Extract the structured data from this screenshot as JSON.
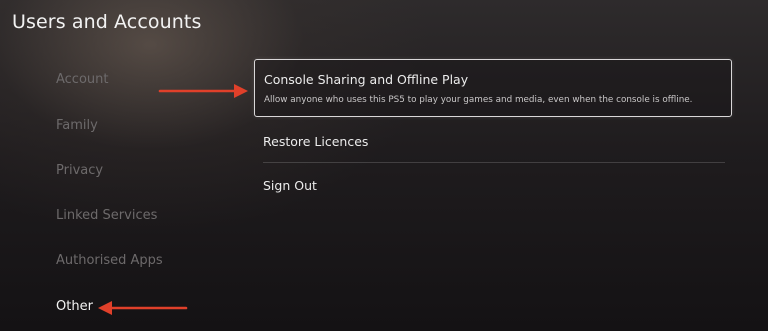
{
  "header": {
    "title": "Users and Accounts"
  },
  "sidebar": {
    "items": [
      {
        "label": "Account"
      },
      {
        "label": "Family"
      },
      {
        "label": "Privacy"
      },
      {
        "label": "Linked Services"
      },
      {
        "label": "Authorised Apps"
      },
      {
        "label": "Other",
        "active": true
      }
    ]
  },
  "main": {
    "options": [
      {
        "title": "Console Sharing and Offline Play",
        "description": "Allow anyone who uses this PS5 to play your games and media, even when the console is offline.",
        "focused": true
      },
      {
        "title": "Restore Licences"
      },
      {
        "title": "Sign Out"
      }
    ]
  },
  "annotations": {
    "arrow_color": "#e0402a",
    "arrows": [
      "arrow-right-icon",
      "arrow-left-icon"
    ]
  },
  "colors": {
    "background": "#1f1c1e",
    "text_primary": "#f2f2f2",
    "text_muted": "#6d6a6b",
    "focus_border": "#d9d7d8"
  }
}
